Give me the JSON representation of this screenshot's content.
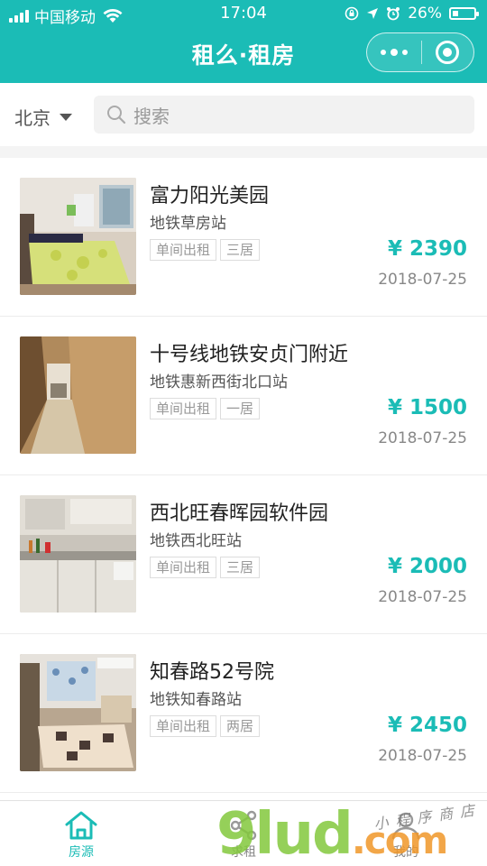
{
  "status_bar": {
    "carrier": "中国移动",
    "time": "17:04",
    "battery": "26%",
    "battery_level": 0.26
  },
  "nav": {
    "title": "租么·租房"
  },
  "search": {
    "city": "北京",
    "placeholder": "搜索"
  },
  "listings": [
    {
      "name": "富力阳光美园",
      "station": "地铁草房站",
      "tags": [
        "单间出租",
        "三居"
      ],
      "price": "¥ 2390",
      "date": "2018-07-25"
    },
    {
      "name": "十号线地铁安贞门附近",
      "station": "地铁惠新西街北口站",
      "tags": [
        "单间出租",
        "一居"
      ],
      "price": "¥ 1500",
      "date": "2018-07-25"
    },
    {
      "name": "西北旺春晖园软件园",
      "station": "地铁西北旺站",
      "tags": [
        "单间出租",
        "三居"
      ],
      "price": "¥ 2000",
      "date": "2018-07-25"
    },
    {
      "name": "知春路52号院",
      "station": "地铁知春路站",
      "tags": [
        "单间出租",
        "两居"
      ],
      "price": "¥ 2450",
      "date": "2018-07-25"
    }
  ],
  "tabbar": {
    "tabs": [
      {
        "label": "房源",
        "icon": "home-icon",
        "active": true
      },
      {
        "label": "求租",
        "icon": "share-icon",
        "active": false
      },
      {
        "label": "我的",
        "icon": "user-icon",
        "active": false
      }
    ]
  },
  "watermark": {
    "main": "9lud",
    "suffix": ".com",
    "small": "小程序商店"
  },
  "colors": {
    "accent": "#1bbcb6",
    "price": "#1bbcb6"
  }
}
